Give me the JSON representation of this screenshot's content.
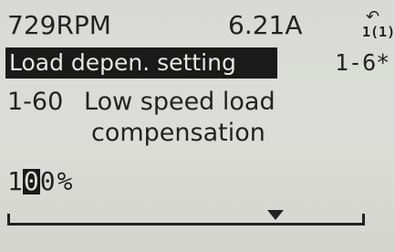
{
  "status": {
    "speed": "729RPM",
    "current": "6.21A",
    "setup_arrow": "↶",
    "setup_text": "1(1)"
  },
  "menu": {
    "title": "Load depen. setting",
    "code": "1-6*"
  },
  "parameter": {
    "number": "1-60",
    "name_line1": "Low speed load",
    "name_line2": "compensation"
  },
  "value": {
    "digit_before": "1",
    "cursor_digit": "0",
    "digit_after": "0",
    "unit": "%",
    "level": 0.75
  },
  "icons": {
    "setup": "setup-switch-icon",
    "marker": "triangle-down-icon"
  },
  "colors": {
    "lcd_background": "#d9dad5",
    "lcd_text": "#222222",
    "inverse_background": "#1a1a1a"
  }
}
